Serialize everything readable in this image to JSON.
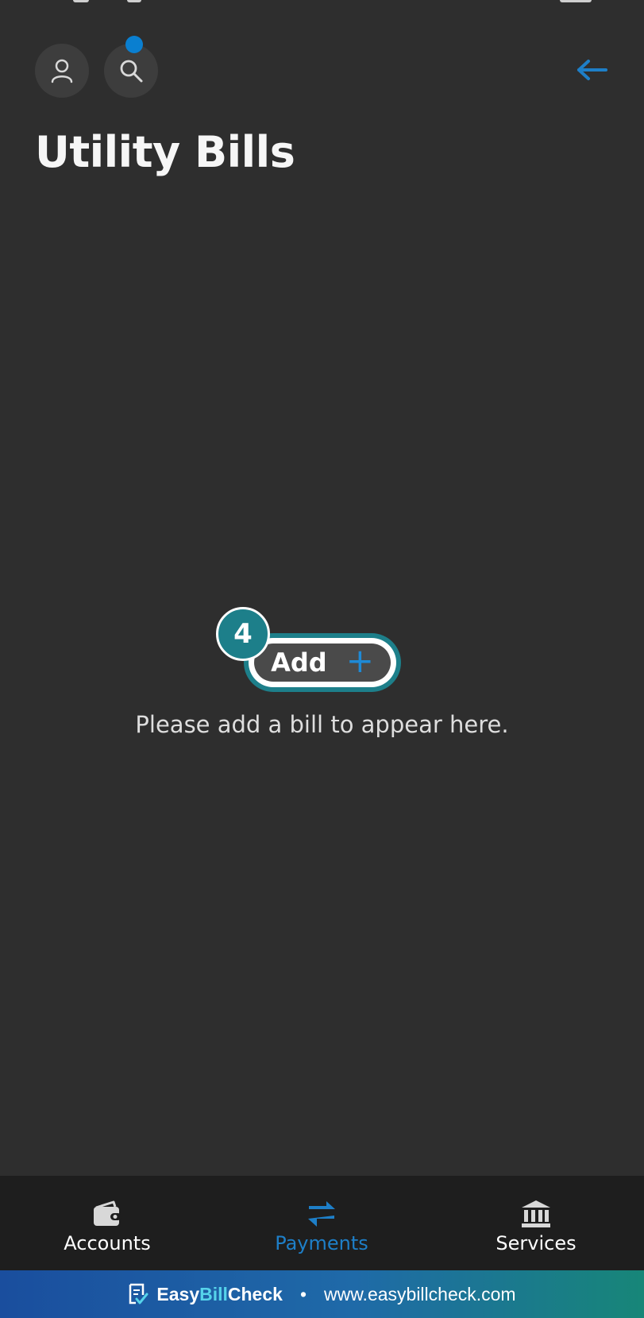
{
  "header": {
    "title": "Utility Bills",
    "icons": [
      "person-icon",
      "search-icon",
      "back-arrow-icon"
    ]
  },
  "main": {
    "add_button_label": "Add",
    "add_button_plus": "+",
    "step_badge": "4",
    "empty_message": "Please add a bill to appear here."
  },
  "bottom_nav": {
    "items": [
      {
        "label": "Accounts",
        "icon": "wallet-icon",
        "active": false
      },
      {
        "label": "Payments",
        "icon": "transfer-arrows-icon",
        "active": true
      },
      {
        "label": "Services",
        "icon": "bank-icon",
        "active": false
      }
    ]
  },
  "footer": {
    "brand_part1": "Easy",
    "brand_part2": "Bill",
    "brand_part3": "Check",
    "separator": "•",
    "url": "www.easybillcheck.com"
  },
  "colors": {
    "background": "#2e2e2e",
    "accent_blue": "#1e7fc8",
    "teal": "#1d7f8a",
    "nav_background": "#1e1e1e"
  }
}
